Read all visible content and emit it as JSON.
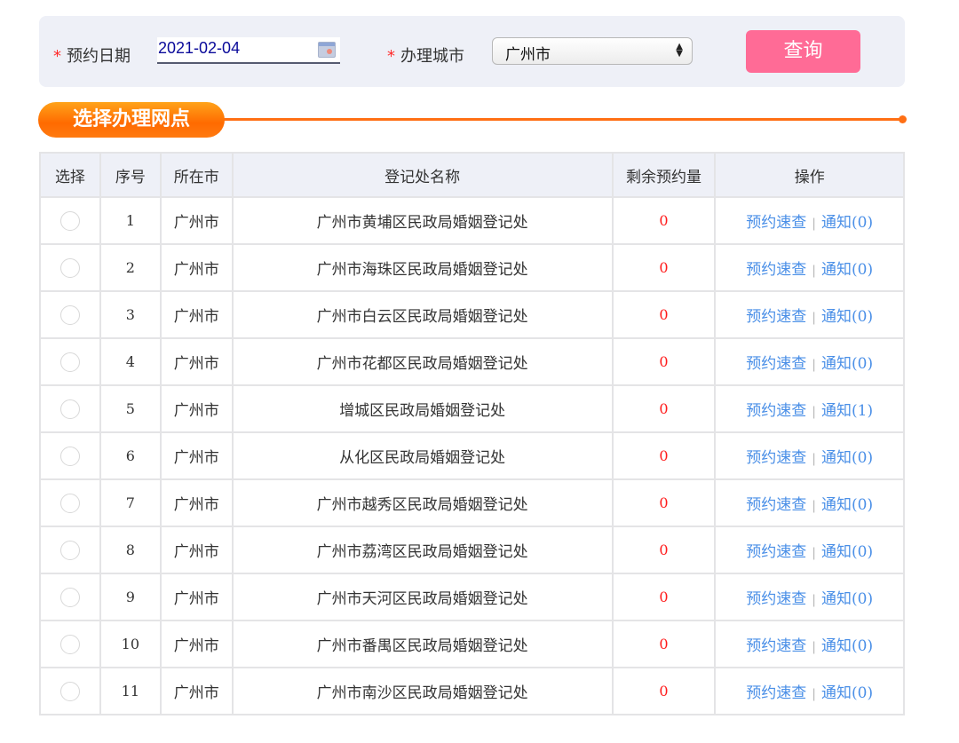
{
  "search": {
    "date_label": "预约日期",
    "date_value": "2021-02-04",
    "city_label": "办理城市",
    "city_value": "广州市",
    "required_mark": "*",
    "query_button": "查询"
  },
  "section": {
    "title": "选择办理网点"
  },
  "table": {
    "headers": [
      "选择",
      "序号",
      "所在市",
      "登记处名称",
      "剩余预约量",
      "操作"
    ],
    "rows": [
      {
        "no": "1",
        "city": "广州市",
        "name": "广州市黄埔区民政局婚姻登记处",
        "remain": "0",
        "query": "预约速查",
        "notice": "通知(0)"
      },
      {
        "no": "2",
        "city": "广州市",
        "name": "广州市海珠区民政局婚姻登记处",
        "remain": "0",
        "query": "预约速查",
        "notice": "通知(0)"
      },
      {
        "no": "3",
        "city": "广州市",
        "name": "广州市白云区民政局婚姻登记处",
        "remain": "0",
        "query": "预约速查",
        "notice": "通知(0)"
      },
      {
        "no": "4",
        "city": "广州市",
        "name": "广州市花都区民政局婚姻登记处",
        "remain": "0",
        "query": "预约速查",
        "notice": "通知(0)"
      },
      {
        "no": "5",
        "city": "广州市",
        "name": "增城区民政局婚姻登记处",
        "remain": "0",
        "query": "预约速查",
        "notice": "通知(1)"
      },
      {
        "no": "6",
        "city": "广州市",
        "name": "从化区民政局婚姻登记处",
        "remain": "0",
        "query": "预约速查",
        "notice": "通知(0)"
      },
      {
        "no": "7",
        "city": "广州市",
        "name": "广州市越秀区民政局婚姻登记处",
        "remain": "0",
        "query": "预约速查",
        "notice": "通知(0)"
      },
      {
        "no": "8",
        "city": "广州市",
        "name": "广州市荔湾区民政局婚姻登记处",
        "remain": "0",
        "query": "预约速查",
        "notice": "通知(0)"
      },
      {
        "no": "9",
        "city": "广州市",
        "name": "广州市天河区民政局婚姻登记处",
        "remain": "0",
        "query": "预约速查",
        "notice": "通知(0)"
      },
      {
        "no": "10",
        "city": "广州市",
        "name": "广州市番禺区民政局婚姻登记处",
        "remain": "0",
        "query": "预约速查",
        "notice": "通知(0)"
      },
      {
        "no": "11",
        "city": "广州市",
        "name": "广州市南沙区民政局婚姻登记处",
        "remain": "0",
        "query": "预约速查",
        "notice": "通知(0)"
      }
    ],
    "separator": "|"
  },
  "colors": {
    "accent_orange": "#ff6f14",
    "query_button": "#ff6b96",
    "link_blue": "#4a8fe7",
    "remain_red": "#ff1a1a",
    "required_red": "#ff2a2a"
  }
}
